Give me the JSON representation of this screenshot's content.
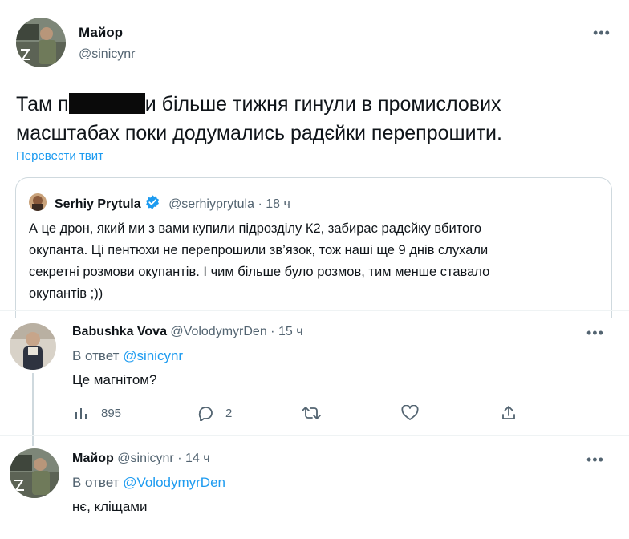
{
  "main_tweet": {
    "author_name": "Майор",
    "author_handle": "@sinicynr",
    "more": "•••",
    "text_line1_start": "Там п",
    "text_line1_end": "и більше тижня гинули в промислових",
    "text_line2": "масштабах поки додумались радєйки перепрошити.",
    "translate": "Перевести твит"
  },
  "quote": {
    "author_name": "Serhiy Prytula",
    "author_handle": "@serhiyprytula",
    "sep": "·",
    "time": "18 ч",
    "text_line1": "А це дрон, який ми з вами купили підрозділу К2, забирає радєйку вбитого",
    "text_line2": "окупанта. Ці пентюхи не перепрошили зв’язок, тож наші ще 9 днів слухали",
    "text_line3": "секретні розмови окупантів. І чим більше було розмов, тим менше ставало",
    "text_line4": "окупантів ;))"
  },
  "reply1": {
    "author_name": "Babushka Vova",
    "author_handle": "@VolodymyrDen",
    "sep": "·",
    "time": "15 ч",
    "more": "•••",
    "reply_to_prefix": "В ответ",
    "reply_to_handle": "@sinicynr",
    "text": "Це магнітом?",
    "views": "895",
    "replies": "2"
  },
  "reply2": {
    "author_name": "Майор",
    "author_handle": "@sinicynr",
    "sep": "·",
    "time": "14 ч",
    "more": "•••",
    "reply_to_prefix": "В ответ",
    "reply_to_handle": "@VolodymyrDen",
    "text": "нє, кліщами"
  },
  "icons": [
    "avatar",
    "more-icon",
    "verified-icon",
    "views-icon",
    "reply-icon",
    "retweet-icon",
    "like-icon",
    "share-icon"
  ],
  "colors": {
    "accent": "#1d9bf0",
    "secondary_text": "#536471",
    "border": "#cfd9de"
  }
}
